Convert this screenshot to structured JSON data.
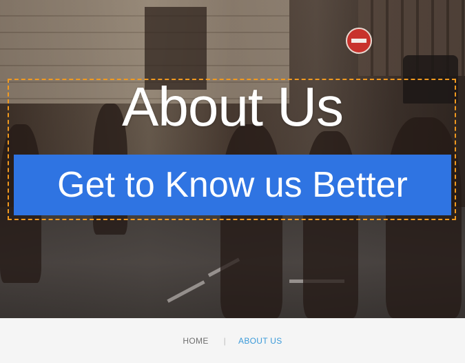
{
  "hero": {
    "title": "About Us",
    "subtitle": "Get to Know us Better",
    "accent_color": "#2f74e2",
    "highlight_color": "#f29a1f"
  },
  "breadcrumb": {
    "home_label": "HOME",
    "separator": "|",
    "current_label": "ABOUT US",
    "current_color": "#3a9ad9"
  }
}
